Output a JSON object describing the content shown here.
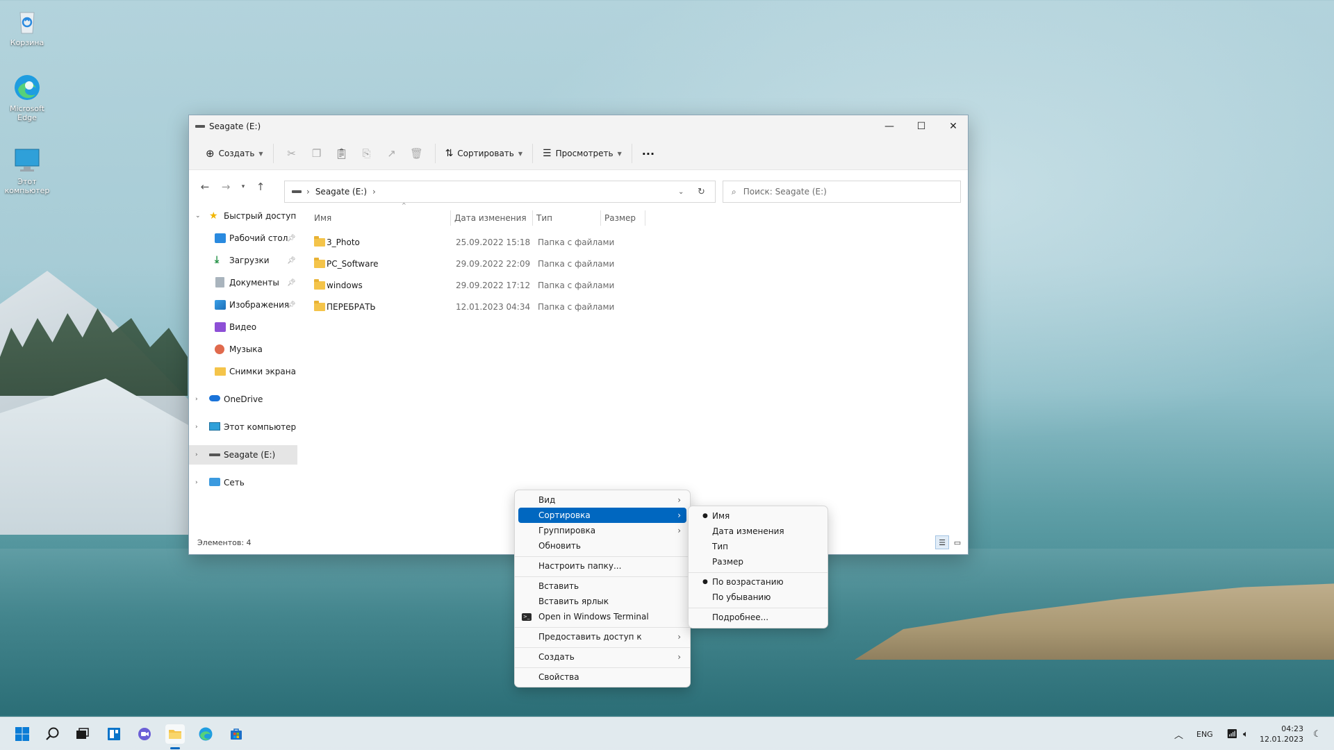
{
  "desktop": {
    "icons": [
      {
        "label": "Корзина",
        "icon": "recycle-bin-icon"
      },
      {
        "label": "Microsoft Edge",
        "icon": "edge-icon"
      },
      {
        "label": "Этот компьютер",
        "icon": "this-pc-icon"
      }
    ]
  },
  "window": {
    "title": "Seagate (E:)",
    "controls": {
      "minimize": "—",
      "maximize": "☐",
      "close": "✕"
    },
    "toolbar": {
      "create_label": "Создать",
      "sort_label": "Сортировать",
      "view_label": "Просмотреть",
      "more_label": "···"
    },
    "address": {
      "path": "Seagate (E:)",
      "search_placeholder": "Поиск: Seagate (E:)"
    },
    "navpane": {
      "quick_access": "Быстрый доступ",
      "quick_items": [
        {
          "label": "Рабочий стол",
          "icon": "desktop-folder-icon"
        },
        {
          "label": "Загрузки",
          "icon": "downloads-icon"
        },
        {
          "label": "Документы",
          "icon": "documents-icon"
        },
        {
          "label": "Изображения",
          "icon": "pictures-icon"
        },
        {
          "label": "Видео",
          "icon": "videos-icon"
        },
        {
          "label": "Музыка",
          "icon": "music-icon"
        },
        {
          "label": "Снимки экрана",
          "icon": "folder-icon"
        }
      ],
      "onedrive": "OneDrive",
      "this_pc": "Этот компьютер",
      "drive": "Seagate (E:)",
      "network": "Сеть"
    },
    "columns": {
      "name": "Имя",
      "date": "Дата изменения",
      "type": "Тип",
      "size": "Размер"
    },
    "files": [
      {
        "name": "3_Photo",
        "date": "25.09.2022 15:18",
        "type": "Папка с файлами"
      },
      {
        "name": "PC_Software",
        "date": "29.09.2022 22:09",
        "type": "Папка с файлами"
      },
      {
        "name": "windows",
        "date": "29.09.2022 17:12",
        "type": "Папка с файлами"
      },
      {
        "name": "ПЕРЕБРАТЬ",
        "date": "12.01.2023 04:34",
        "type": "Папка с файлами"
      }
    ],
    "status": "Элементов: 4"
  },
  "context_menu": {
    "items": [
      {
        "label": "Вид",
        "submenu": true
      },
      {
        "label": "Сортировка",
        "submenu": true,
        "highlighted": true
      },
      {
        "label": "Группировка",
        "submenu": true
      },
      {
        "label": "Обновить"
      },
      {
        "label": "Настроить папку..."
      },
      {
        "label": "Вставить"
      },
      {
        "label": "Вставить ярлык"
      },
      {
        "label": "Open in Windows Terminal",
        "icon": "terminal-icon"
      },
      {
        "label": "Предоставить доступ к",
        "submenu": true
      },
      {
        "label": "Создать",
        "submenu": true
      },
      {
        "label": "Свойства"
      }
    ]
  },
  "sort_submenu": {
    "items": [
      {
        "label": "Имя",
        "selected": true
      },
      {
        "label": "Дата изменения"
      },
      {
        "label": "Тип"
      },
      {
        "label": "Размер"
      },
      {
        "label": "По возрастанию",
        "selected": true
      },
      {
        "label": "По убыванию"
      },
      {
        "label": "Подробнее..."
      }
    ]
  },
  "taskbar": {
    "apps": [
      "start-icon",
      "search-icon",
      "task-view-icon",
      "widgets-icon",
      "chat-icon",
      "file-explorer-icon",
      "edge-icon",
      "store-icon"
    ],
    "language": "ENG",
    "time": "04:23",
    "date": "12.01.2023"
  },
  "colors": {
    "accent": "#0067c0",
    "folder": "#f4c44a"
  }
}
